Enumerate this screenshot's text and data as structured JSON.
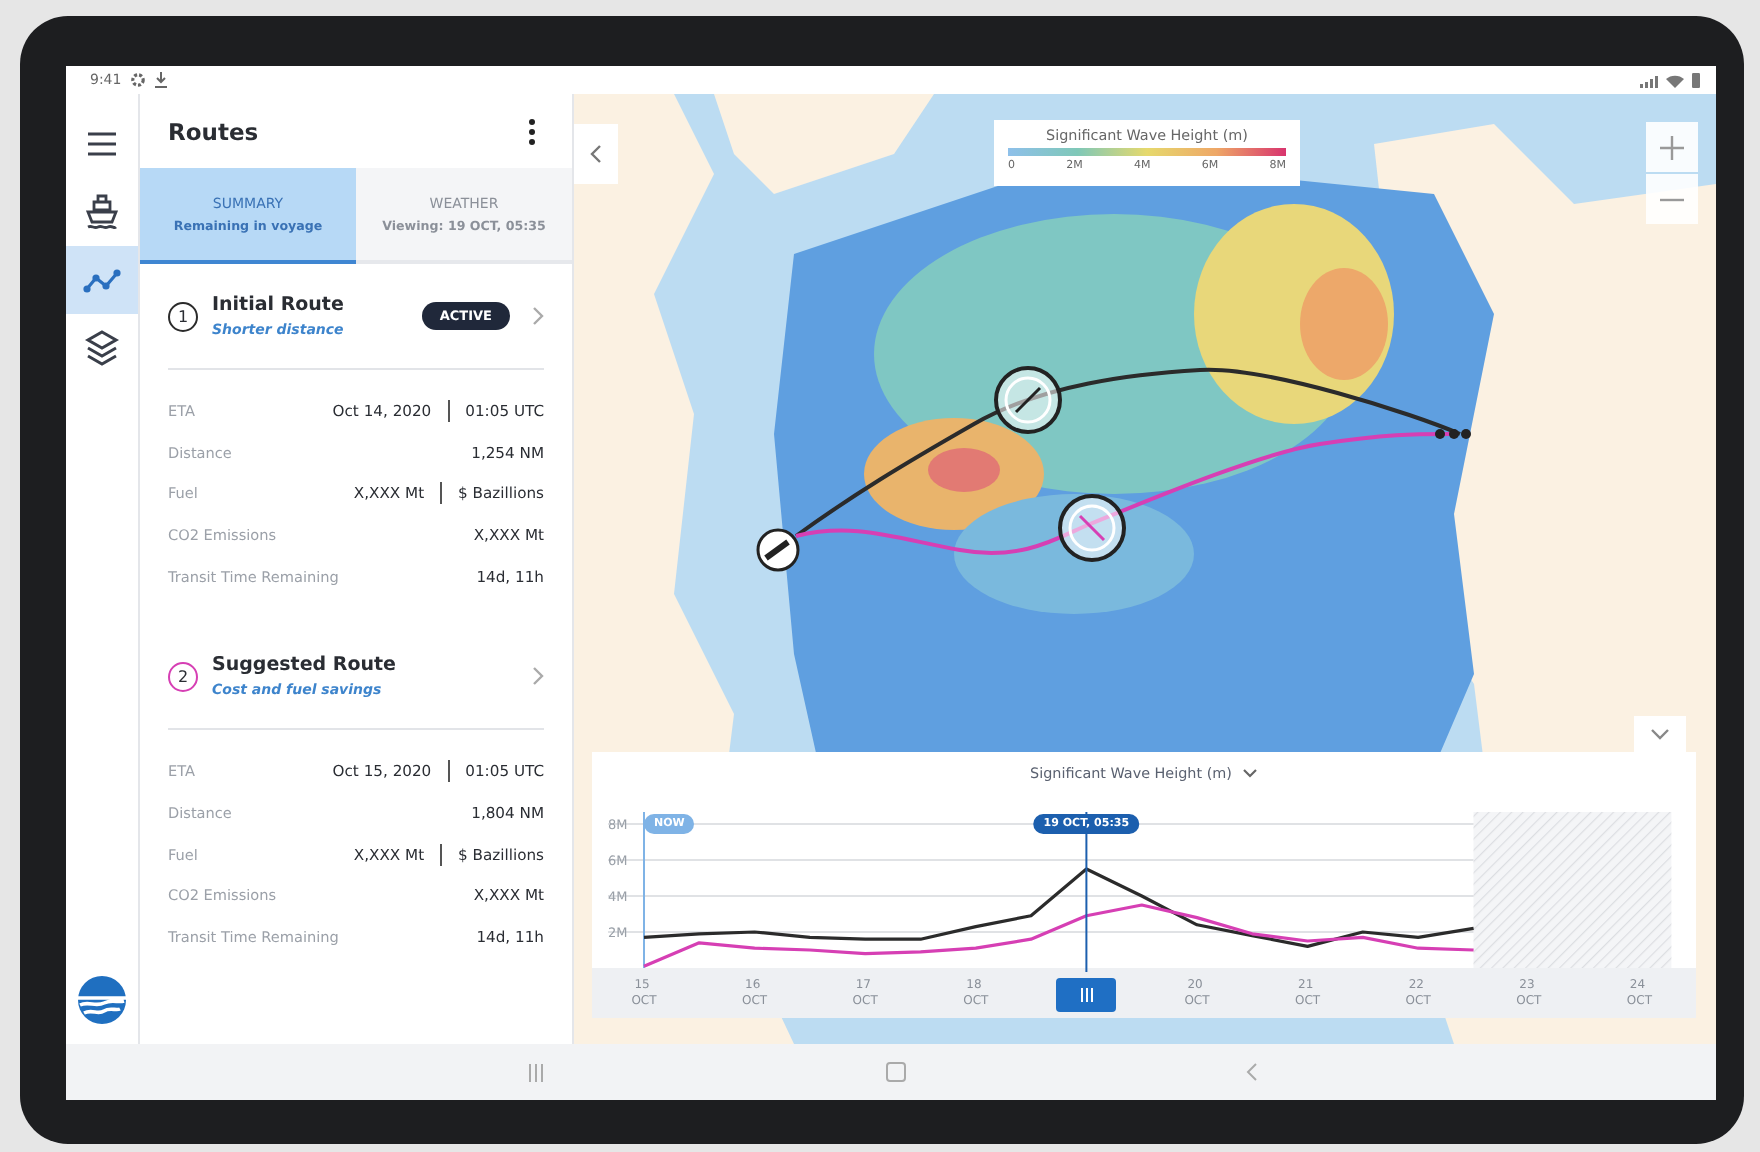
{
  "status_bar": {
    "time": "9:41"
  },
  "rail": {
    "items": [
      {
        "kind": "menu",
        "selected": false
      },
      {
        "kind": "ship",
        "selected": false
      },
      {
        "kind": "route",
        "selected": true
      },
      {
        "kind": "layers",
        "selected": false
      }
    ]
  },
  "panel": {
    "title": "Routes",
    "tabs": [
      {
        "label": "SUMMARY",
        "sublabel": "Remaining in voyage",
        "selected": true
      },
      {
        "label": "WEATHER",
        "sublabel": "Viewing: 19 OCT, 05:35",
        "selected": false
      }
    ],
    "routes": [
      {
        "number": "1",
        "name": "Initial Route",
        "subtitle": "Shorter distance",
        "color": "#2b2b2b",
        "badge": "ACTIVE",
        "stats": [
          {
            "label": "ETA",
            "values": [
              "Oct 14, 2020",
              "01:05 UTC"
            ]
          },
          {
            "label": "Distance",
            "values": [
              "1,254 NM"
            ]
          },
          {
            "label": "Fuel",
            "values": [
              "X,XXX Mt",
              "$ Bazillions"
            ]
          },
          {
            "label": "CO2 Emissions",
            "values": [
              "X,XXX Mt"
            ]
          },
          {
            "label": "Transit Time Remaining",
            "values": [
              "14d, 11h"
            ]
          }
        ]
      },
      {
        "number": "2",
        "name": "Suggested Route",
        "subtitle": "Cost and fuel savings",
        "color": "#d63fb4",
        "stats": [
          {
            "label": "ETA",
            "values": [
              "Oct 15, 2020",
              "01:05 UTC"
            ]
          },
          {
            "label": "Distance",
            "values": [
              "1,804 NM"
            ]
          },
          {
            "label": "Fuel",
            "values": [
              "X,XXX Mt",
              "$ Bazillions"
            ]
          },
          {
            "label": "CO2 Emissions",
            "values": [
              "X,XXX Mt"
            ]
          },
          {
            "label": "Transit Time Remaining",
            "values": [
              "14d, 11h"
            ]
          }
        ]
      }
    ]
  },
  "map": {
    "kind": "picture",
    "legend": {
      "title": "Significant Wave Height (m)",
      "ticks": [
        "0",
        "2M",
        "4M",
        "6M",
        "8M"
      ]
    }
  },
  "chart": {
    "now_label": "NOW",
    "cursor_label": "19 OCT, 05:35",
    "chart_data": {
      "type": "line",
      "title": "Significant Wave Height (m)",
      "categories": [
        "15 OCT",
        null,
        "16 OCT",
        null,
        "17 OCT",
        null,
        "18 OCT",
        null,
        null,
        null,
        "20 OCT",
        null,
        "21 OCT",
        null,
        "22 OCT",
        null,
        "23 OCT",
        null,
        "24 OCT"
      ],
      "series": [
        {
          "color": "#2b2b2b",
          "values": [
            1.7,
            1.9,
            2.0,
            1.7,
            1.6,
            1.6,
            2.3,
            2.9,
            5.5,
            4.0,
            2.4,
            1.8,
            1.2,
            2.0,
            1.7,
            2.2,
            null,
            null,
            null
          ]
        },
        {
          "color": "#d63fb4",
          "values": [
            0.1,
            1.4,
            1.1,
            1.0,
            0.8,
            0.9,
            1.1,
            1.6,
            2.9,
            3.5,
            2.8,
            1.9,
            1.5,
            1.7,
            1.1,
            1.0,
            null,
            null,
            null
          ]
        }
      ],
      "ylim": [
        0,
        8
      ],
      "grid": true,
      "yticks": [
        {
          "value": 2,
          "label": "2M"
        },
        {
          "value": 4,
          "label": "4M"
        },
        {
          "value": 6,
          "label": "6M"
        },
        {
          "value": 8,
          "label": "8M"
        }
      ]
    }
  }
}
